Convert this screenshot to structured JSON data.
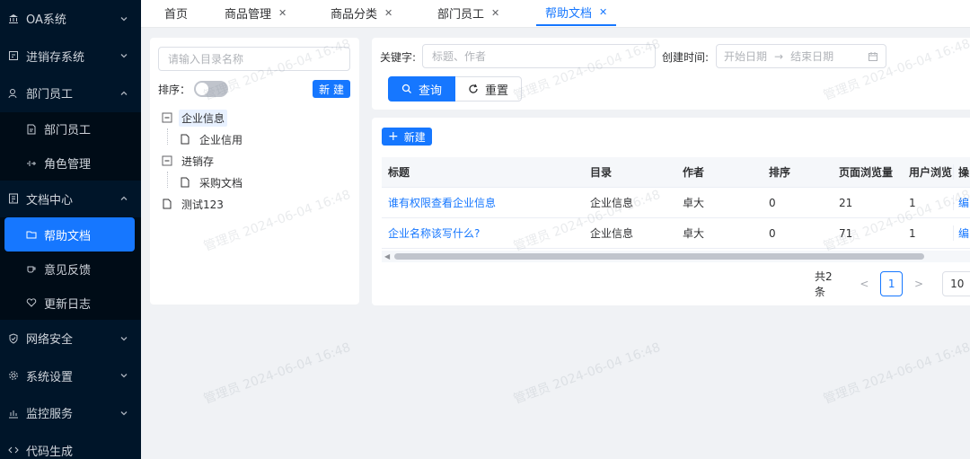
{
  "sidebar": {
    "items": [
      {
        "label": "OA系统",
        "icon": "bank-icon"
      },
      {
        "label": "进销存系统",
        "icon": "store-icon"
      },
      {
        "label": "部门员工",
        "icon": "user-icon"
      },
      {
        "label": "文档中心",
        "icon": "doc-icon"
      },
      {
        "label": "网络安全",
        "icon": "shield-icon"
      },
      {
        "label": "系统设置",
        "icon": "gear-icon"
      },
      {
        "label": "监控服务",
        "icon": "chart-icon"
      },
      {
        "label": "代码生成",
        "icon": "code-icon"
      }
    ],
    "dept_children": [
      {
        "label": "部门员工",
        "icon": "file-user-icon"
      },
      {
        "label": "角色管理",
        "icon": "role-icon"
      }
    ],
    "doc_children": [
      {
        "label": "帮助文档",
        "icon": "folder-icon"
      },
      {
        "label": "意见反馈",
        "icon": "cup-icon"
      },
      {
        "label": "更新日志",
        "icon": "heart-icon"
      }
    ]
  },
  "tabs": [
    {
      "label": "首页",
      "closable": false
    },
    {
      "label": "商品管理",
      "closable": true
    },
    {
      "label": "商品分类",
      "closable": true
    },
    {
      "label": "部门员工",
      "closable": true
    },
    {
      "label": "帮助文档",
      "closable": true,
      "active": true
    }
  ],
  "tree_panel": {
    "search_placeholder": "请输入目录名称",
    "sort_label": "排序：",
    "new_label": "新 建",
    "nodes": {
      "n1": "企业信息",
      "n1_1": "企业信用",
      "n2": "进销存",
      "n2_1": "采购文档",
      "n3": "测试123"
    }
  },
  "filter": {
    "keyword_label": "关键字:",
    "keyword_placeholder": "标题、作者",
    "created_label": "创建时间:",
    "start_placeholder": "开始日期",
    "range_arrow": "→",
    "end_placeholder": "结束日期",
    "search_btn": "查询",
    "reset_btn": "重置"
  },
  "table": {
    "new_btn": "新建",
    "headers": [
      "标题",
      "目录",
      "作者",
      "排序",
      "页面浏览量",
      "用户浏览",
      "操"
    ],
    "rows": [
      [
        "谁有权限查看企业信息",
        "企业信息",
        "卓大",
        "0",
        "21",
        "1",
        "编"
      ],
      [
        "企业名称该写什么?",
        "企业信息",
        "卓大",
        "0",
        "71",
        "1",
        "编"
      ]
    ]
  },
  "pager": {
    "total": "共2条",
    "prev": "<",
    "current": "1",
    "next": ">",
    "size": "10"
  },
  "watermark": "管理员 2024-06-04 16:48",
  "colors": {
    "primary": "#1677ff",
    "sidebar_bg": "#001529"
  }
}
